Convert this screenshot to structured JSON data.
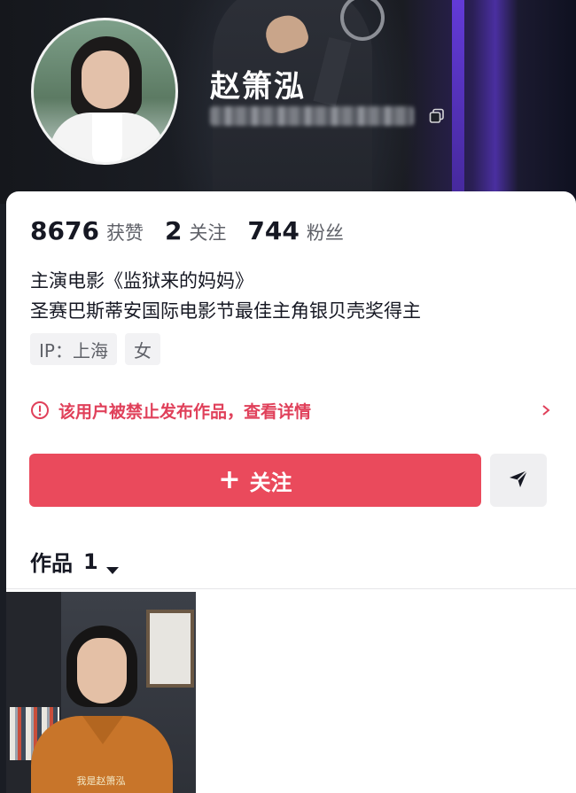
{
  "profile": {
    "name": "赵箫泓",
    "uid_masked": "抖音号：2..."
  },
  "stats": [
    {
      "value": "8676",
      "label": "获赞"
    },
    {
      "value": "2",
      "label": "关注"
    },
    {
      "value": "744",
      "label": "粉丝"
    }
  ],
  "bio": {
    "line1": "主演电影《监狱来的妈妈》",
    "line2": "圣赛巴斯蒂安国际电影节最佳主角银贝壳奖得主"
  },
  "tags": [
    "IP：上海",
    "女"
  ],
  "notice": {
    "text": "该用户被禁止发布作品，查看详情",
    "color": "#e0405a"
  },
  "actions": {
    "follow_plus": "+",
    "follow_label": "关注",
    "follow_color": "#ea4a5c"
  },
  "works": {
    "label": "作品",
    "count": "1"
  },
  "thumbnail": {
    "caption": "我是赵箫泓"
  }
}
